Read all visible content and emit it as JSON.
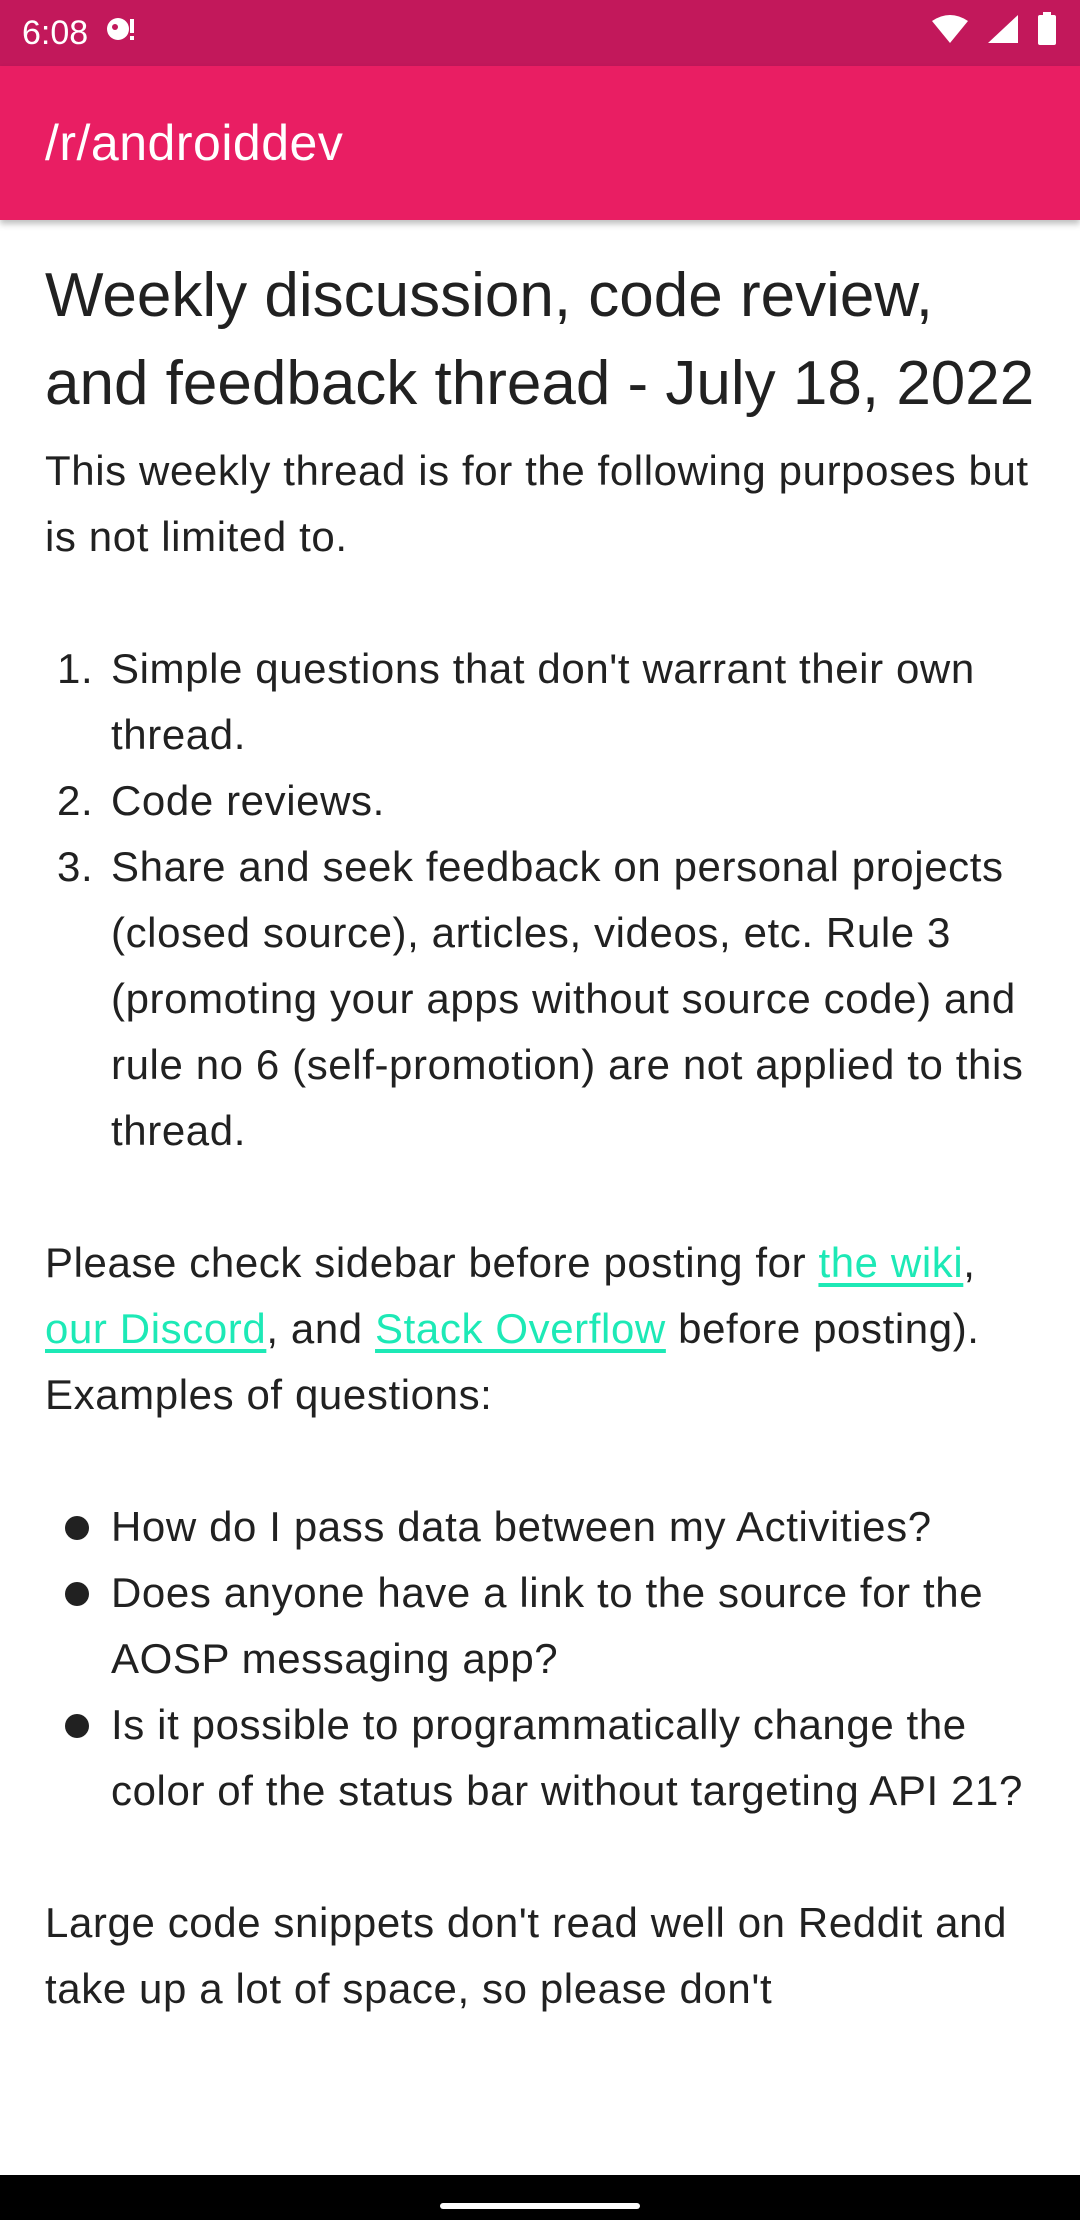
{
  "status_bar": {
    "time": "6:08",
    "icons": [
      "notification-icon",
      "wifi-icon",
      "signal-icon",
      "battery-icon"
    ]
  },
  "app_bar": {
    "title": "/r/androiddev"
  },
  "post": {
    "title": "Weekly discussion, code review, and feedback thread - July 18, 2022",
    "intro": "This weekly thread is for the following purposes but is not limited to.",
    "purposes": [
      {
        "num": "1.",
        "text": "Simple questions that don't warrant their own thread."
      },
      {
        "num": "2.",
        "text": "Code reviews."
      },
      {
        "num": "3.",
        "text": "Share and seek feedback on personal projects (closed source), articles, videos, etc. Rule 3 (promoting your apps without source code) and rule no 6 (self-promotion) are not applied to this thread."
      }
    ],
    "sidebar": {
      "text_before": "Please check sidebar before posting for ",
      "link_wiki": "the wiki",
      "sep1": ", ",
      "link_discord": "our Discord",
      "sep2": ", and ",
      "link_stackoverflow": "Stack Overflow",
      "text_after": " before posting). Examples of questions:"
    },
    "examples": [
      "How do I pass data between my Activities?",
      "Does anyone have a link to the source for the AOSP messaging app?",
      "Is it possible to programmatically change the color of the status bar without targeting API 21?"
    ],
    "closing": "Large code snippets don't read well on Reddit and take up a lot of space, so please don't"
  },
  "colors": {
    "status_bar": "#c2185b",
    "app_bar": "#e91e63",
    "link": "#1de9b6",
    "text": "#212121"
  }
}
